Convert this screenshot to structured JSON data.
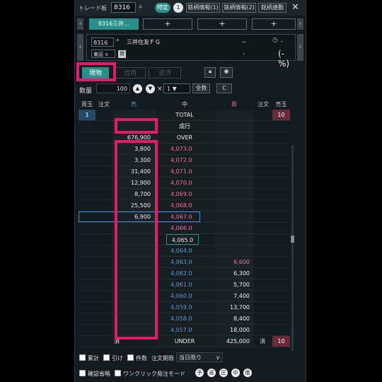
{
  "header": {
    "title": "トレード板",
    "code": "8316",
    "tokutei": "特定",
    "count": "1",
    "btn1": "銘柄情報(1)",
    "btn2": "銘柄情報(2)",
    "btn3": "銘柄連動",
    "close": "✕"
  },
  "tabs": [
    {
      "label": "8316三井…"
    },
    {
      "label": "+"
    },
    {
      "label": "+"
    },
    {
      "label": "+"
    }
  ],
  "info": {
    "code": "8316",
    "name": "三井住友ＦＧ",
    "market": "東証",
    "lending": "貸",
    "dash1": "－",
    "dash2": "-",
    "dash3": "-",
    "pct": "(-%)"
  },
  "order": {
    "genbutsu": "現物",
    "shinyo": "信用",
    "hensai": "返済"
  },
  "qty": {
    "label": "数量",
    "value": "100",
    "x": "×",
    "mult": "1",
    "zen": "全数",
    "c": "C"
  },
  "board_headers": {
    "kaigyoku": "買玉",
    "chumon_l": "注文",
    "uri": "売",
    "naka": "中",
    "kai": "買",
    "chumon_r": "注文",
    "urigyoku": "売玉"
  },
  "rows": [
    {
      "kg": "1",
      "sell": "",
      "price": "TOTAL",
      "buy": "",
      "ug": "10"
    },
    {
      "kg": "",
      "sell": "",
      "price": "成行",
      "buy": "",
      "ug": ""
    },
    {
      "kg": "",
      "sell": "676,900",
      "price": "OVER",
      "buy": "",
      "ug": ""
    },
    {
      "kg": "",
      "sell": "3,800",
      "price": "4,073.0",
      "buy": "",
      "ug": ""
    },
    {
      "kg": "",
      "sell": "3,300",
      "price": "4,072.0",
      "buy": "",
      "ug": ""
    },
    {
      "kg": "",
      "sell": "31,400",
      "price": "4,071.0",
      "buy": "",
      "ug": ""
    },
    {
      "kg": "",
      "sell": "12,900",
      "price": "4,070.0",
      "buy": "",
      "ug": ""
    },
    {
      "kg": "",
      "sell": "8,700",
      "price": "4,069.0",
      "buy": "",
      "ug": ""
    },
    {
      "kg": "",
      "sell": "25,500",
      "price": "4,068.0",
      "buy": "",
      "ug": ""
    },
    {
      "kg": "",
      "sell": "6,900",
      "price": "4,067.0",
      "buy": "",
      "ug": ""
    },
    {
      "kg": "",
      "sell": "",
      "price": "4,066.0",
      "buy": "",
      "ug": ""
    },
    {
      "kg": "",
      "sell": "",
      "price": "4,065.0",
      "buy": "",
      "ug": ""
    },
    {
      "kg": "",
      "sell": "",
      "price": "4,064.0",
      "buy": "",
      "ug": ""
    },
    {
      "kg": "",
      "sell": "",
      "price": "4,063.0",
      "buy": "6,600",
      "ug": ""
    },
    {
      "kg": "",
      "sell": "",
      "price": "4,062.0",
      "buy": "6,300",
      "ug": ""
    },
    {
      "kg": "",
      "sell": "",
      "price": "4,061.0",
      "buy": "5,700",
      "ug": ""
    },
    {
      "kg": "",
      "sell": "",
      "price": "4,060.0",
      "buy": "7,400",
      "ug": ""
    },
    {
      "kg": "",
      "sell": "",
      "price": "4,059.0",
      "buy": "13,700",
      "ug": ""
    },
    {
      "kg": "",
      "sell": "",
      "price": "4,058.0",
      "buy": "8,400",
      "ug": ""
    },
    {
      "kg": "",
      "sell": "",
      "price": "4,057.0",
      "buy": "18,000",
      "ug": ""
    },
    {
      "kg": "",
      "sell": "消",
      "price": "UNDER",
      "buy": "425,000",
      "ug": "10"
    }
  ],
  "under_left": "消",
  "footer": {
    "ruikei": "累計",
    "hikike": "引け",
    "kensu": "件数",
    "kigen_label": "注文期限",
    "kigen": "当日限り",
    "kakunin": "確認省略",
    "oneclick": "ワンクリック発注モード",
    "r1": "予",
    "r2": "返",
    "r3": "圧",
    "r4": "中",
    "r5": "僧"
  },
  "colors": {
    "accent": "#2a8f8b",
    "highlight": "#e6196b",
    "ask": "#f06fa0",
    "bid": "#5b9bd5"
  }
}
